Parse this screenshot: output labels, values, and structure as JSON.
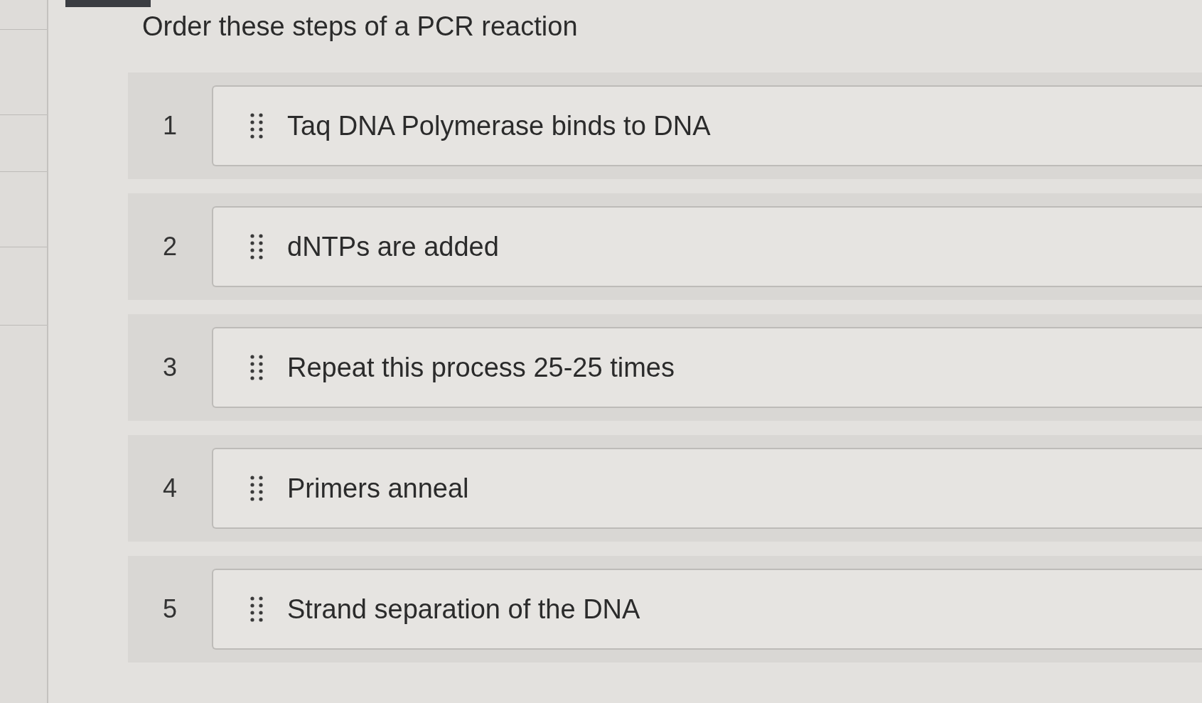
{
  "question": {
    "title": "Order these steps of a PCR reaction"
  },
  "steps": [
    {
      "number": "1",
      "label": "Taq DNA Polymerase binds to DNA"
    },
    {
      "number": "2",
      "label": "dNTPs are added"
    },
    {
      "number": "3",
      "label": "Repeat this process 25-25 times"
    },
    {
      "number": "4",
      "label": "Primers anneal"
    },
    {
      "number": "5",
      "label": "Strand separation of the DNA"
    }
  ]
}
